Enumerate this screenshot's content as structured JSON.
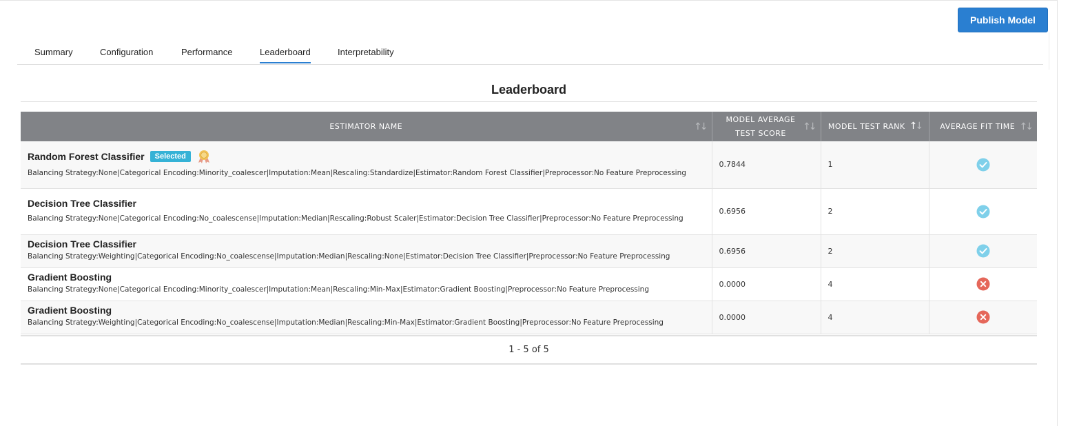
{
  "header": {
    "publish_label": "Publish Model"
  },
  "tabs": [
    {
      "label": "Summary",
      "active": false
    },
    {
      "label": "Configuration",
      "active": false
    },
    {
      "label": "Performance",
      "active": false
    },
    {
      "label": "Leaderboard",
      "active": true
    },
    {
      "label": "Interpretability",
      "active": false
    }
  ],
  "section_title": "Leaderboard",
  "table": {
    "columns": [
      {
        "label": "ESTIMATOR NAME",
        "sort": "none"
      },
      {
        "label": "MODEL AVERAGE TEST SCORE",
        "sort": "none"
      },
      {
        "label": "MODEL TEST RANK",
        "sort": "ascending"
      },
      {
        "label": "AVERAGE FIT TIME",
        "sort": "none"
      }
    ],
    "rows": [
      {
        "name": "Random Forest Classifier",
        "badge": "Selected",
        "icon": "award-medal-icon",
        "description": "Balancing Strategy:None|Categorical Encoding:Minority_coalescer|Imputation:Mean|Rescaling:Standardize|Estimator:Random Forest Classifier|Preprocessor:No Feature Preprocessing",
        "score": "0.7844",
        "rank": "1",
        "fit_status": "success"
      },
      {
        "name": "Decision Tree Classifier",
        "description": "Balancing Strategy:None|Categorical Encoding:No_coalescense|Imputation:Median|Rescaling:Robust Scaler|Estimator:Decision Tree Classifier|Preprocessor:No Feature Preprocessing",
        "score": "0.6956",
        "rank": "2",
        "fit_status": "success"
      },
      {
        "name": "Decision Tree Classifier",
        "description": "Balancing Strategy:Weighting|Categorical Encoding:No_coalescense|Imputation:Median|Rescaling:None|Estimator:Decision Tree Classifier|Preprocessor:No Feature Preprocessing",
        "score": "0.6956",
        "rank": "2",
        "fit_status": "success"
      },
      {
        "name": "Gradient Boosting",
        "description": "Balancing Strategy:None|Categorical Encoding:Minority_coalescer|Imputation:Mean|Rescaling:Min-Max|Estimator:Gradient Boosting|Preprocessor:No Feature Preprocessing",
        "score": "0.0000",
        "rank": "4",
        "fit_status": "failed"
      },
      {
        "name": "Gradient Boosting",
        "description": "Balancing Strategy:Weighting|Categorical Encoding:No_coalescense|Imputation:Median|Rescaling:Min-Max|Estimator:Gradient Boosting|Preprocessor:No Feature Preprocessing",
        "score": "0.0000",
        "rank": "4",
        "fit_status": "failed"
      }
    ]
  },
  "pagination": {
    "text": "1 - 5 of 5"
  },
  "colors": {
    "accent": "#2a7fd1",
    "header_bg": "#818387",
    "badge": "#35b2d6",
    "success": "#7fd0ea",
    "failed": "#e5675a"
  }
}
